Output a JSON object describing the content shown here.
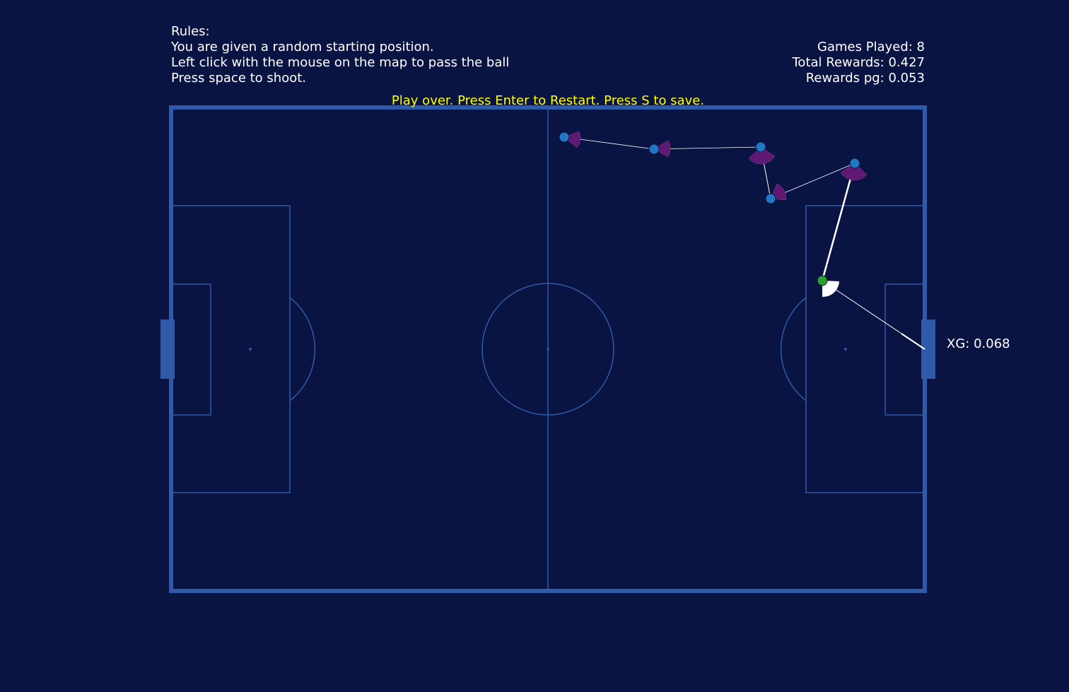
{
  "rules": {
    "title": "Rules:",
    "lines": [
      "You are given a random starting position.",
      "Left click with the mouse on the map to pass the ball",
      "Press space to shoot."
    ]
  },
  "stats": {
    "games_played": "Games Played: 8",
    "total_rewards": "Total Rewards: 0.427",
    "rewards_pg": "Rewards pg: 0.053"
  },
  "status_message": "Play over. Press Enter to Restart. Press S to save.",
  "xg_label": "XG: 0.068",
  "colors": {
    "background": "#0a1442",
    "pitch_lines": "#2e5aa8",
    "player": "#2277c4",
    "ball_carrier": "#2ca02c",
    "vision_cone": "#5e1a72",
    "status_text": "#ffff00",
    "pass_line": "#ffffff"
  }
}
